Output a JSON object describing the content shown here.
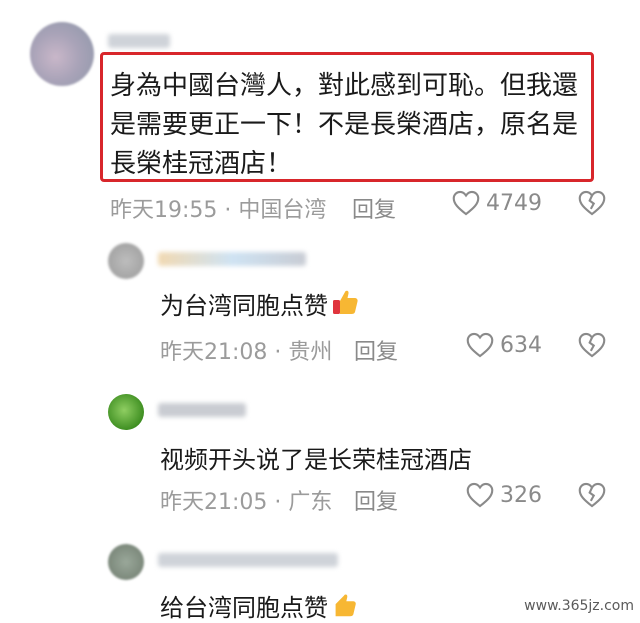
{
  "comments": [
    {
      "text_lines": [
        "身為中國台灣人，對此感到可恥。但我還",
        "是需要更正一下！不是長榮酒店，原名是",
        "長榮桂冠酒店！"
      ],
      "time": "昨天19:55 · 中国台湾",
      "reply_label": "回复",
      "likes": "4749"
    },
    {
      "text": "为台湾同胞点赞",
      "time": "昨天21:08 · 贵州",
      "reply_label": "回复",
      "likes": "634"
    },
    {
      "text": "视频开头说了是长荣桂冠酒店",
      "time": "昨天21:05 · 广东",
      "reply_label": "回复",
      "likes": "326"
    },
    {
      "text": "给台湾同胞点赞"
    }
  ],
  "watermark": "www.365jz.com",
  "colors": {
    "highlight": "#d8262b",
    "meta": "#9b9b9b"
  },
  "icons": [
    "heart-outline-icon",
    "broken-heart-icon",
    "thumbs-up-emoji"
  ]
}
